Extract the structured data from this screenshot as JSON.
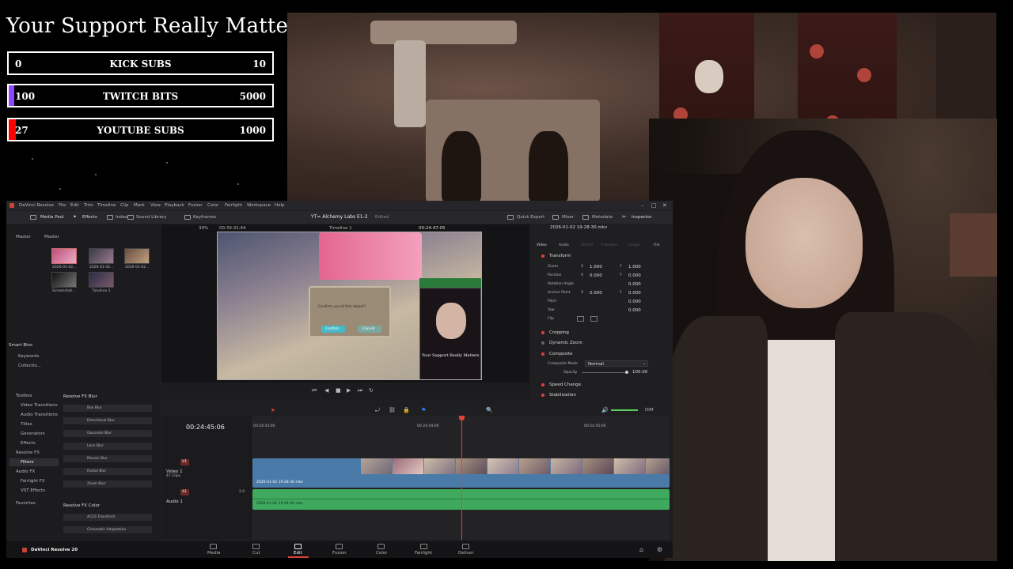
{
  "overlay": {
    "title": "Your Support Really Matters",
    "goals": [
      {
        "current": "0",
        "label": "KICK SUBS",
        "max": "10",
        "fill_color": "#53fc18",
        "progress": 0.0
      },
      {
        "current": "100",
        "label": "TWITCH BITS",
        "max": "5000",
        "fill_color": "#9146ff",
        "progress": 0.02
      },
      {
        "current": "27",
        "label": "YOUTUBE SUBS",
        "max": "1000",
        "fill_color": "#ff0000",
        "progress": 0.027
      }
    ]
  },
  "resolve": {
    "menubar": {
      "app_name": "DaVinci Resolve",
      "items": [
        "File",
        "Edit",
        "Trim",
        "Timeline",
        "Clip",
        "Mark",
        "View",
        "Playback",
        "Fusion",
        "Color",
        "Fairlight",
        "Workspace",
        "Help"
      ]
    },
    "toolbar": {
      "media_pool": "Media Pool",
      "effects": "Effects",
      "index": "Index",
      "sound_library": "Sound Library",
      "keyframes": "Keyframes",
      "project_title": "YT= Alchemy Labs E1-2",
      "edited": "Edited",
      "quick_export": "Quick Export",
      "mixer": "Mixer",
      "metadata": "Metadata",
      "inspector": "Inspector"
    },
    "media_pool": {
      "master_tab": "Master",
      "bin_label": "Master",
      "clips": [
        {
          "name": "2026-01-02..."
        },
        {
          "name": "2026-01-02..."
        },
        {
          "name": "2026-01-02..."
        },
        {
          "name": "Screenshot..."
        },
        {
          "name": "Timeline 1"
        }
      ],
      "smart_bins": "Smart Bins",
      "smart_bin_items": [
        "Keywords",
        "Collectio..."
      ]
    },
    "viewer": {
      "zoom": "39%",
      "source_timecode": "00:39:31:44",
      "timeline_name": "Timeline 1",
      "record_timecode": "00:24:47:05",
      "dialog_text": "Confirm use of this object?",
      "confirm_btn": "Confirm",
      "cancel_btn": "Cancel",
      "pip_caption": "Your Support Really Matters"
    },
    "inspector": {
      "clip_name": "2026-01-02 19-28-30.mkv",
      "tabs": [
        "Video",
        "Audio",
        "Effects",
        "Transition",
        "Image",
        "File"
      ],
      "sections": {
        "transform": "Transform",
        "cropping": "Cropping",
        "dynamic_zoom": "Dynamic Zoom",
        "composite": "Composite",
        "speed_change": "Speed Change",
        "stabilization": "Stabilization"
      },
      "rows": [
        {
          "label": "Zoom",
          "a": "X",
          "av": "1.000",
          "b": "Y",
          "bv": "1.000"
        },
        {
          "label": "Position",
          "a": "X",
          "av": "0.000",
          "b": "Y",
          "bv": "0.000"
        },
        {
          "label": "Rotation Angle",
          "a": "",
          "av": "",
          "b": "",
          "bv": "0.000"
        },
        {
          "label": "Anchor Point",
          "a": "X",
          "av": "0.000",
          "b": "Y",
          "bv": "0.000"
        },
        {
          "label": "Pitch",
          "a": "",
          "av": "",
          "b": "",
          "bv": "0.000"
        },
        {
          "label": "Yaw",
          "a": "",
          "av": "",
          "b": "",
          "bv": "0.000"
        },
        {
          "label": "Flip",
          "a": "",
          "av": "",
          "b": "",
          "bv": ""
        }
      ],
      "composite_mode_label": "Composite Mode",
      "composite_mode_value": "Normal",
      "opacity_label": "Opacity",
      "opacity_value": "100.00"
    },
    "effects": {
      "toolbox": "Toolbox",
      "tree": [
        "Video Transitions",
        "Audio Transitions",
        "Titles",
        "Generators",
        "Effects",
        "Resolve FX",
        "Filters",
        "Audio FX",
        "Fairlight FX",
        "VST Effects",
        "Favorites"
      ],
      "group1_title": "Resolve FX Blur",
      "group1_items": [
        "Box Blur",
        "Directional Blur",
        "Gaussian Blur",
        "Lens Blur",
        "Mosaic Blur",
        "Radial Blur",
        "Zoom Blur"
      ],
      "group2_title": "Resolve FX Color",
      "group2_items": [
        "ACES Transform",
        "Chromatic Adaptation"
      ]
    },
    "timeline": {
      "timecode": "00:24:45:06",
      "ruler": [
        "00:24:43:00",
        "00:24:44:00",
        "00:24:45:00"
      ],
      "video_track": {
        "id": "V1",
        "name": "Video 1",
        "count": "47 Clips",
        "clip_name": "2026-01-02 19-28-30.mkv"
      },
      "audio_track": {
        "id": "A1",
        "name": "Audio 1",
        "level": "2.0",
        "clip_name": "2026-01-02 19-28-30.mkv"
      },
      "dim": "DIM"
    },
    "pages": {
      "version": "DaVinci Resolve 20",
      "tabs": [
        "Media",
        "Cut",
        "Edit",
        "Fusion",
        "Color",
        "Fairlight",
        "Deliver"
      ],
      "active": "Edit"
    }
  }
}
